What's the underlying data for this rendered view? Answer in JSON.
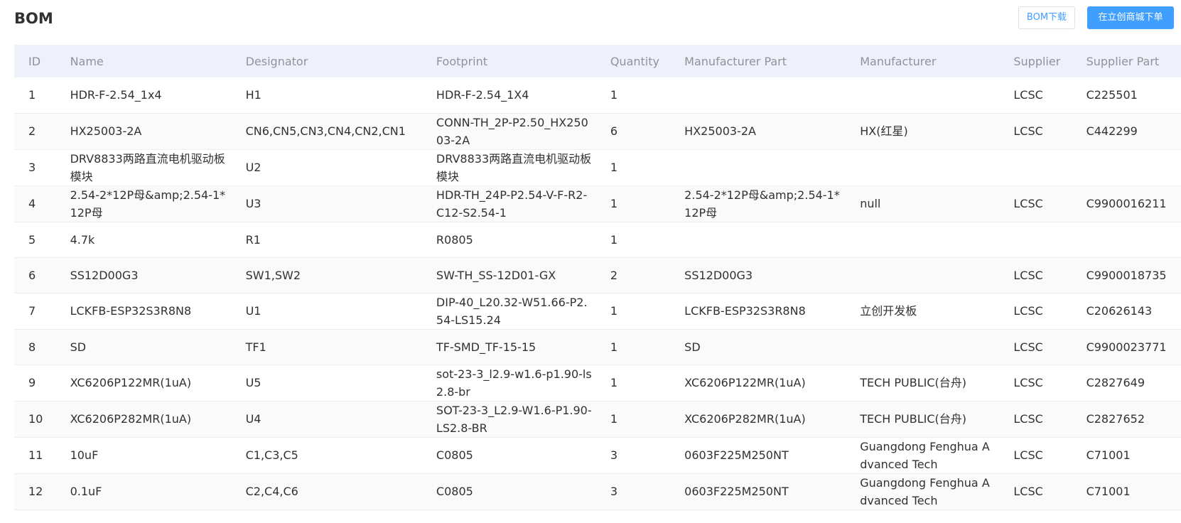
{
  "header": {
    "title": "BOM",
    "download_label": "BOM下载",
    "order_label": "在立创商城下单"
  },
  "table": {
    "columns": [
      "ID",
      "Name",
      "Designator",
      "Footprint",
      "Quantity",
      "Manufacturer Part",
      "Manufacturer",
      "Supplier",
      "Supplier Part"
    ],
    "rows": [
      [
        "1",
        "HDR-F-2.54_1x4",
        "H1",
        "HDR-F-2.54_1X4",
        "1",
        "",
        "",
        "LCSC",
        "C225501"
      ],
      [
        "2",
        "HX25003-2A",
        "CN6,CN5,CN3,CN4,CN2,CN1",
        "CONN-TH_2P-P2.50_HX25003-2A",
        "6",
        "HX25003-2A",
        "HX(红星)",
        "LCSC",
        "C442299"
      ],
      [
        "3",
        "DRV8833两路直流电机驱动板模块",
        "U2",
        "DRV8833两路直流电机驱动板模块",
        "1",
        "",
        "",
        "",
        ""
      ],
      [
        "4",
        "2.54-2*12P母&amp;2.54-1*12P母",
        "U3",
        "HDR-TH_24P-P2.54-V-F-R2-C12-S2.54-1",
        "1",
        "2.54-2*12P母&amp;2.54-1*12P母",
        "null",
        "LCSC",
        "C9900016211"
      ],
      [
        "5",
        "4.7k",
        "R1",
        "R0805",
        "1",
        "",
        "",
        "",
        ""
      ],
      [
        "6",
        "SS12D00G3",
        "SW1,SW2",
        "SW-TH_SS-12D01-GX",
        "2",
        "SS12D00G3",
        "",
        "LCSC",
        "C9900018735"
      ],
      [
        "7",
        "LCKFB-ESP32S3R8N8",
        "U1",
        "DIP-40_L20.32-W51.66-P2.54-LS15.24",
        "1",
        "LCKFB-ESP32S3R8N8",
        "立创开发板",
        "LCSC",
        "C20626143"
      ],
      [
        "8",
        "SD",
        "TF1",
        "TF-SMD_TF-15-15",
        "1",
        "SD",
        "",
        "LCSC",
        "C9900023771"
      ],
      [
        "9",
        "XC6206P122MR(1uA)",
        "U5",
        "sot-23-3_l2.9-w1.6-p1.90-ls2.8-br",
        "1",
        "XC6206P122MR(1uA)",
        "TECH PUBLIC(台舟)",
        "LCSC",
        "C2827649"
      ],
      [
        "10",
        "XC6206P282MR(1uA)",
        "U4",
        "SOT-23-3_L2.9-W1.6-P1.90-LS2.8-BR",
        "1",
        "XC6206P282MR(1uA)",
        "TECH PUBLIC(台舟)",
        "LCSC",
        "C2827652"
      ],
      [
        "11",
        "10uF",
        "C1,C3,C5",
        "C0805",
        "3",
        "0603F225M250NT",
        "Guangdong Fenghua Advanced Tech",
        "LCSC",
        "C71001"
      ],
      [
        "12",
        "0.1uF",
        "C2,C4,C6",
        "C0805",
        "3",
        "0603F225M250NT",
        "Guangdong Fenghua Advanced Tech",
        "LCSC",
        "C71001"
      ]
    ]
  }
}
